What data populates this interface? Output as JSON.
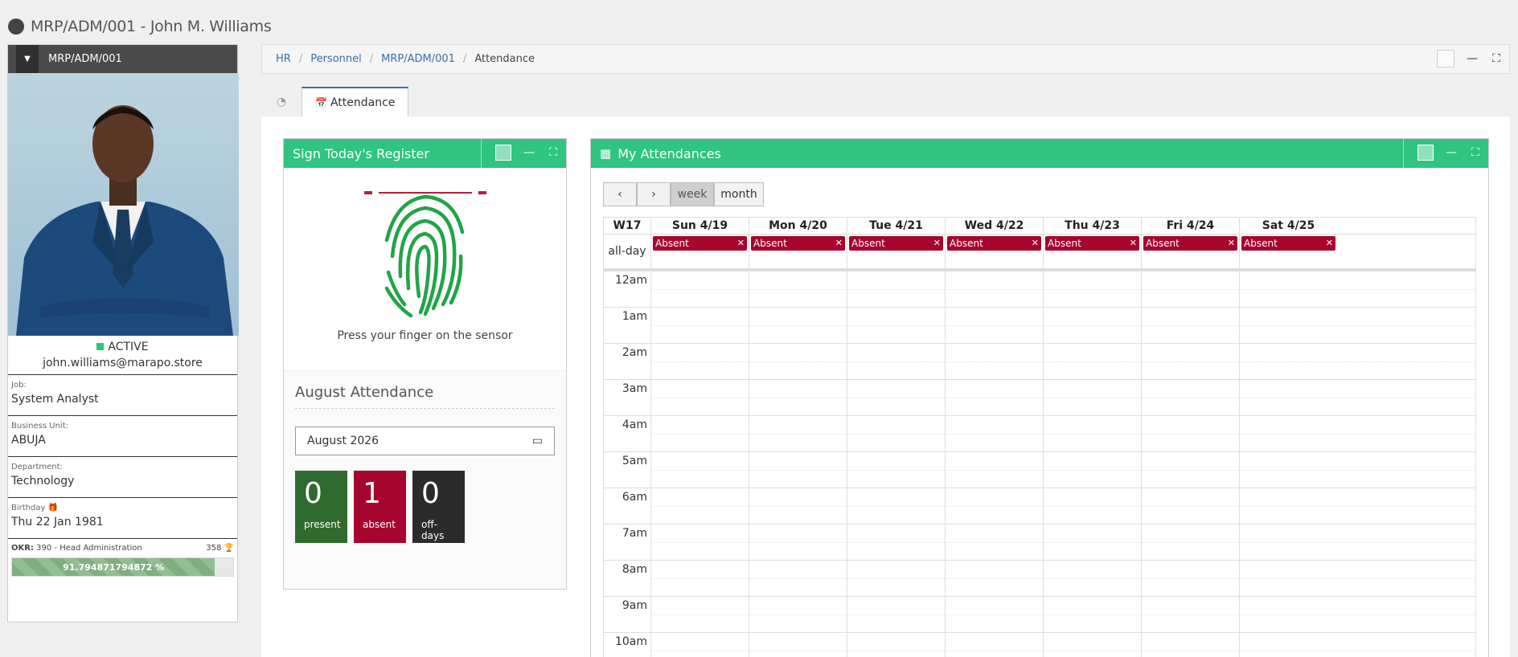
{
  "header": {
    "title": "MRP/ADM/001 - John M. Williams"
  },
  "profile": {
    "code": "MRP/ADM/001",
    "status": "ACTIVE",
    "email": "john.williams@marapo.store",
    "fields": [
      {
        "label": "Job:",
        "value": "System Analyst"
      },
      {
        "label": "Business Unit:",
        "value": "ABUJA"
      },
      {
        "label": "Department:",
        "value": "Technology"
      },
      {
        "label": "Birthday",
        "value": "Thu 22 Jan 1981"
      }
    ],
    "okr": {
      "label": "OKR:",
      "text": "390 - Head Administration",
      "score": "358",
      "progress_label": "91.794871794872 %",
      "progress": 91.794871794872
    }
  },
  "breadcrumb": {
    "items": [
      "HR",
      "Personnel",
      "MRP/ADM/001"
    ],
    "current": "Attendance"
  },
  "tabs": {
    "active": "Attendance"
  },
  "register": {
    "title": "Sign Today's Register",
    "prompt": "Press your finger on the sensor",
    "month_title": "August Attendance",
    "month_value": "August  2026",
    "stats": [
      {
        "value": "0",
        "label": "present",
        "color": "#2f6b2f"
      },
      {
        "value": "1",
        "label": "absent",
        "color": "#a6052e"
      },
      {
        "value": "0",
        "label": "off-days",
        "color": "#2b2b2b"
      }
    ]
  },
  "calendar": {
    "title": "My Attendances",
    "views": [
      "week",
      "month"
    ],
    "active_view": "week",
    "week_label": "W17",
    "days": [
      "Sun 4/19",
      "Mon 4/20",
      "Tue 4/21",
      "Wed 4/22",
      "Thu 4/23",
      "Fri 4/24",
      "Sat 4/25"
    ],
    "allday_label": "all-day",
    "event_label": "Absent",
    "hours": [
      "12am",
      "1am",
      "2am",
      "3am",
      "4am",
      "5am",
      "6am",
      "7am",
      "8am",
      "9am",
      "10am"
    ]
  },
  "colors": {
    "accent_green": "#2fc47f",
    "absent_red": "#a6052e",
    "link_blue": "#3a6ea5"
  }
}
